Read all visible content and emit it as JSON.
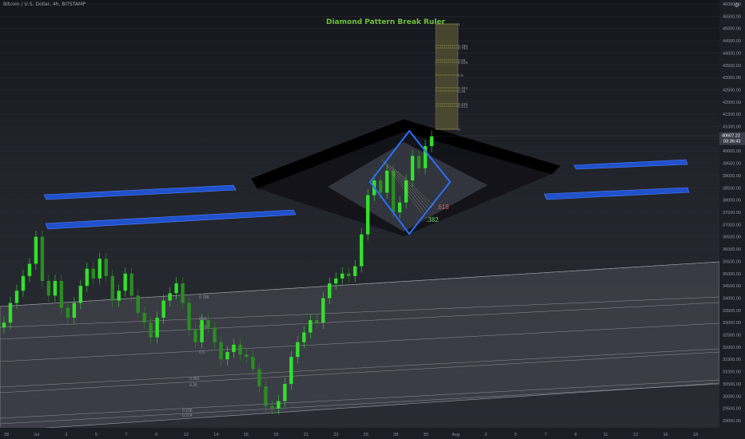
{
  "header": {
    "symbol": "Bitcoin / U.S. Dollar, 4h, BITSTAMP",
    "indicator_title": "Diamond Pattern Break Ruler"
  },
  "colors": {
    "up_candle": "#33e02b",
    "down_candle": "#2a8c22",
    "diamond_outline": "#2b6ff5",
    "blue_channel": "#2158e8",
    "ruler_fill": "#6c6a3a",
    "channel_fill": "#4a4c56",
    "price_tag": "#3a3d47"
  },
  "chart_data": {
    "type": "candlestick",
    "price_axis": {
      "ylim": [
        28500,
        46000
      ],
      "ticks": [
        "46000.00",
        "45500.00",
        "45000.00",
        "44500.00",
        "44000.00",
        "43500.00",
        "43000.00",
        "42500.00",
        "42000.00",
        "41500.00",
        "41000.00",
        "40500.00",
        "40000.00",
        "39500.00",
        "39000.00",
        "38500.00",
        "38000.00",
        "37500.00",
        "37000.00",
        "36500.00",
        "36000.00",
        "35500.00",
        "35000.00",
        "34500.00",
        "34000.00",
        "33500.00",
        "33000.00",
        "32500.00",
        "32000.00",
        "31500.00",
        "31000.00",
        "30500.00",
        "30000.00",
        "29500.00",
        "29000.00"
      ],
      "last_price": "40607.22",
      "countdown": "03:36:43"
    },
    "time_axis": {
      "ticks": [
        "28",
        "Jul",
        "3",
        "5",
        "7",
        "9",
        "12",
        "14",
        "16",
        "19",
        "21",
        "23",
        "26",
        "28",
        "30",
        "Aug",
        "3",
        "5",
        "7",
        "9",
        "11",
        "13",
        "16",
        "18"
      ]
    },
    "series": [
      {
        "name": "BTCUSD 4h close path",
        "values": [
          33000,
          33800,
          34300,
          34900,
          35400,
          36500,
          34700,
          34100,
          34700,
          33600,
          33200,
          33800,
          34500,
          35200,
          34800,
          35600,
          34900,
          33900,
          34300,
          35000,
          34100,
          33400,
          33000,
          32400,
          33200,
          33900,
          34200,
          34600,
          33800,
          32700,
          32200,
          33100,
          32800,
          32200,
          31500,
          31800,
          32100,
          31700,
          31600,
          31100,
          30400,
          29600,
          29500,
          29800,
          30500,
          31600,
          32200,
          32600,
          33100,
          33000,
          34000,
          34600,
          34800,
          35000,
          34900,
          35300,
          36600,
          38200,
          38800,
          38300,
          39200,
          37500,
          37900,
          38800,
          39800,
          39300,
          40200,
          40600
        ]
      }
    ],
    "diamond_ruler_levels": [
      "1",
      "0.786",
      "0.764",
      "0.65",
      "0.618",
      "0.5",
      "0.382",
      "0.35",
      "0.236",
      "0.214",
      "0"
    ],
    "diamond_labels": [
      ".618",
      ".382"
    ],
    "channel_levels": [
      "0.786",
      "0.65",
      "0.618",
      "0.5",
      "0.382",
      "0.35",
      "0.236",
      "0.214"
    ]
  }
}
